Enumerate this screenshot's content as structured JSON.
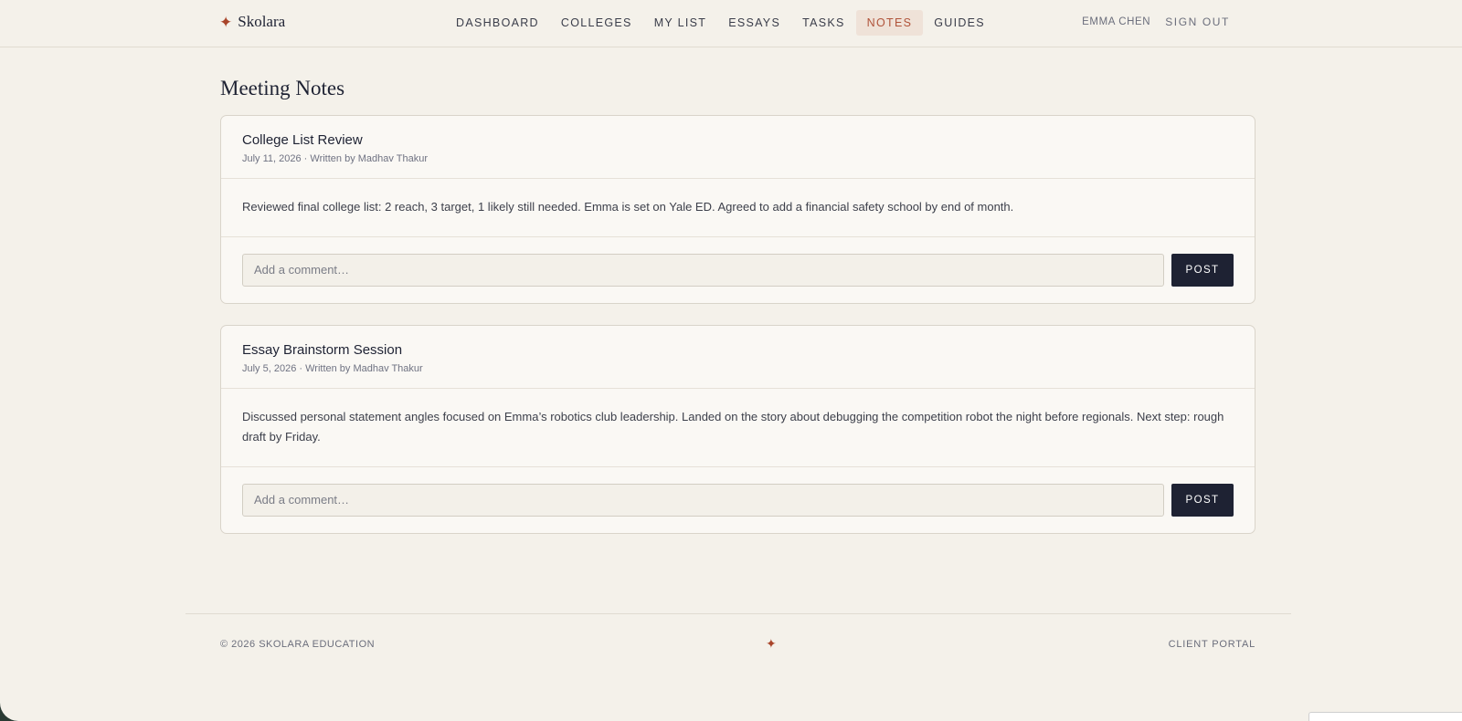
{
  "brand": {
    "icon": "four-point-star-icon",
    "name": "Skolara"
  },
  "nav": {
    "items": [
      {
        "label": "DASHBOARD"
      },
      {
        "label": "COLLEGES"
      },
      {
        "label": "MY LIST"
      },
      {
        "label": "ESSAYS"
      },
      {
        "label": "TASKS"
      },
      {
        "label": "NOTES",
        "active": true
      },
      {
        "label": "GUIDES"
      }
    ]
  },
  "user": {
    "name": "EMMA CHEN",
    "sign_out": "SIGN OUT"
  },
  "page": {
    "title": "Meeting Notes"
  },
  "notes": [
    {
      "title": "College List Review",
      "meta": "July 11, 2026 · Written by Madhav Thakur",
      "body": "Reviewed final college list: 2 reach, 3 target, 1 likely still needed. Emma is set on Yale ED. Agreed to add a financial safety school by end of month.",
      "comment_placeholder": "Add a comment…",
      "post_label": "POST"
    },
    {
      "title": "Essay Brainstorm Session",
      "meta": "July 5, 2026 · Written by Madhav Thakur",
      "body": "Discussed personal statement angles focused on Emma’s robotics club leadership. Landed on the story about debugging the competition robot the night before regionals. Next step: rough draft by Friday.",
      "comment_placeholder": "Add a comment…",
      "post_label": "POST"
    }
  ],
  "footer": {
    "copyright": "© 2026 SKOLARA EDUCATION",
    "center_icon": "four-point-star-icon",
    "right_link": "CLIENT PORTAL"
  },
  "colors": {
    "accent": "#a9452a",
    "navy": "#1e2233",
    "background": "#f4f1ea",
    "card": "#faf8f4",
    "active_tab_bg": "#efe2d8"
  }
}
